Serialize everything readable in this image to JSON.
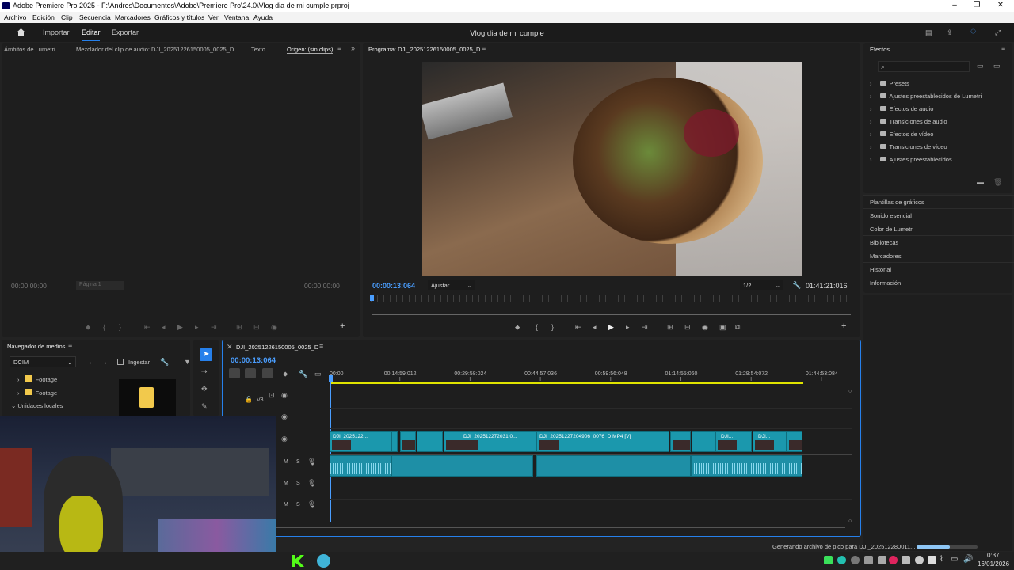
{
  "window": {
    "title": "Adobe Premiere Pro 2025 - F:\\Andres\\Documentos\\Adobe\\Premiere Pro\\24.0\\Vlog dia de mi cumple.prproj",
    "controls": {
      "minimize": "–",
      "maximize": "❐",
      "close": "✕"
    }
  },
  "menu": [
    "Archivo",
    "Edición",
    "Clip",
    "Secuencia",
    "Marcadores",
    "Gráficos y títulos",
    "Ver",
    "Ventana",
    "Ayuda"
  ],
  "header": {
    "nav": [
      "Importar",
      "Editar",
      "Exportar"
    ],
    "active": "Editar",
    "title": "Vlog dia de mi cumple"
  },
  "source_panel": {
    "tabs": [
      "Ámbitos de Lumetri",
      "Mezclador del clip de audio: DJI_20251226150005_0025_D",
      "Texto",
      "Origen: (sin clips)"
    ],
    "tc_left": "00:00:00:00",
    "tc_right": "00:00:00:00",
    "page": "Página 1"
  },
  "program_panel": {
    "title": "Programa: DJI_20251226150005_0025_D",
    "timecode": "00:00:13:064",
    "fit": "Ajustar",
    "resolution": "1/2",
    "duration": "01:41:21:016"
  },
  "effects_panel": {
    "title": "Efectos",
    "search_placeholder": "",
    "items": [
      "Presets",
      "Ajustes preestablecidos de Lumetri",
      "Efectos de audio",
      "Transiciones de audio",
      "Efectos de vídeo",
      "Transiciones de vídeo",
      "Ajustes preestablecidos"
    ]
  },
  "side_panels": [
    "Plantillas de gráficos",
    "Sonido esencial",
    "Color de Lumetri",
    "Bibliotecas",
    "Marcadores",
    "Historial",
    "Información"
  ],
  "media_browser": {
    "title": "Navegador de medios",
    "location": "DCIM",
    "ingest": "Ingestar",
    "tree": [
      "Footage",
      "Footage",
      "Unidades locales"
    ]
  },
  "timeline": {
    "sequence": "DJI_20251226150005_0025_D",
    "timecode": "00:00:13:064",
    "ruler": [
      "00:00",
      "00:14:59:012",
      "00:29:58:024",
      "00:44:57:036",
      "00:59:56:048",
      "01:14:55:060",
      "01:29:54:072",
      "01:44:53:084"
    ],
    "tracks": [
      "V3"
    ],
    "clips": [
      "DJI_2025122...",
      "DJI_202512272031 0...",
      "DJI_20251227204906_0076_D.MP4 [V]",
      "DJI...",
      "DJI..."
    ]
  },
  "status": {
    "text": "Generando archivo de pico para DJI_202512280011...",
    "progress": 0.55
  },
  "clock": {
    "time": "0:37",
    "date": "16/01/2026"
  }
}
